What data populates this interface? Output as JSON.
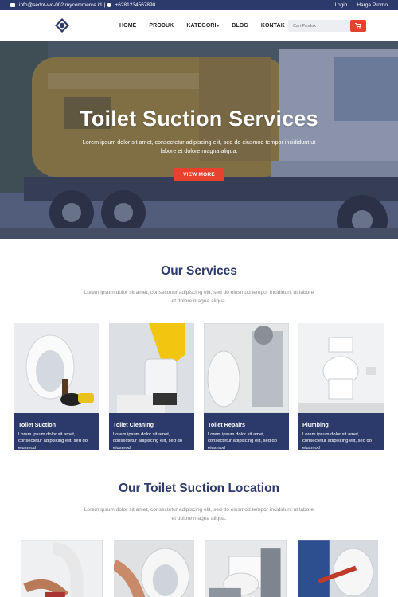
{
  "topbar": {
    "email": "info@sedot-wc-002.mycommerce.id",
    "phone": "+6281234567890",
    "login": "Login",
    "price": "Harga Promo"
  },
  "nav": {
    "items": [
      "HOME",
      "PRODUK",
      "KATEGORI",
      "BLOG",
      "KONTAK"
    ],
    "search_placeholder": "Cari Produk"
  },
  "hero": {
    "title": "Toilet Suction Services",
    "text": "Lorem ipsum dolor sit amet, consectetur adipiscing elit, sed do eiusmod tempor incididunt ut labore et dolore magna aliqua.",
    "button": "VIEW MORE"
  },
  "services": {
    "title": "Our Services",
    "subtitle": "Lorem ipsum dolor sit amet, consectetur adipiscing elit, sed do eiusmod tempor incididunt ut labore et dolore magna aliqua.",
    "cards": [
      {
        "title": "Toilet Suction",
        "desc": "Lorem ipsum dolor sit amet, consectetur adipiscing elit, sed do eiusmod"
      },
      {
        "title": "Toilet Cleaning",
        "desc": "Lorem ipsum dolor sit amet, consectetur adipiscing elit, sed do eiusmod"
      },
      {
        "title": "Toilet Repairs",
        "desc": "Lorem ipsum dolor sit amet, consectetur adipiscing elit, sed do eiusmod"
      },
      {
        "title": "Plumbing",
        "desc": "Lorem ipsum dolor sit amet, consectetur adipiscing elit, sed do eiusmod"
      }
    ]
  },
  "location": {
    "title": "Our Toilet Suction Location",
    "subtitle": "Lorem ipsum dolor sit amet, consectetur adipiscing elit, sed do eiusmod tempor incididunt ut labore et dolore magna aliqua."
  },
  "colors": {
    "navy": "#2b3a6b",
    "accent": "#e8412d"
  },
  "icons": [
    "mail-icon",
    "phone-icon",
    "cart-icon",
    "logo-icon"
  ]
}
